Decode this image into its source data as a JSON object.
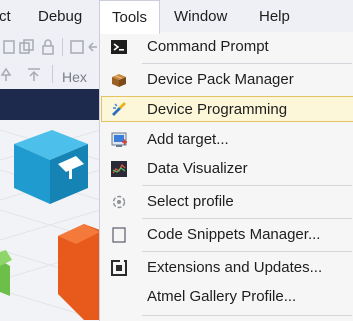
{
  "menubar": {
    "items": [
      "ct",
      "Debug",
      "Tools",
      "Window",
      "Help"
    ]
  },
  "toolbar": {
    "hex_label": "Hex"
  },
  "tools_menu": {
    "items": [
      {
        "label": "Command Prompt",
        "icon": "command-prompt-icon"
      },
      {
        "label": "Device Pack Manager",
        "icon": "package-icon"
      },
      {
        "label": "Device Programming",
        "icon": "device-programming-icon"
      },
      {
        "label": "Add target...",
        "icon": "add-target-icon"
      },
      {
        "label": "Data Visualizer",
        "icon": "data-visualizer-icon"
      },
      {
        "label": "Select profile",
        "icon": "select-profile-icon"
      },
      {
        "label": "Code Snippets Manager...",
        "icon": "code-snippets-icon"
      },
      {
        "label": "Extensions and Updates...",
        "icon": "extensions-icon"
      },
      {
        "label": "Atmel Gallery Profile...",
        "icon": ""
      }
    ]
  },
  "colors": {
    "highlight_bg": "#fdf7d9",
    "highlight_border": "#e5c365",
    "navy": "#1d2a4e"
  }
}
